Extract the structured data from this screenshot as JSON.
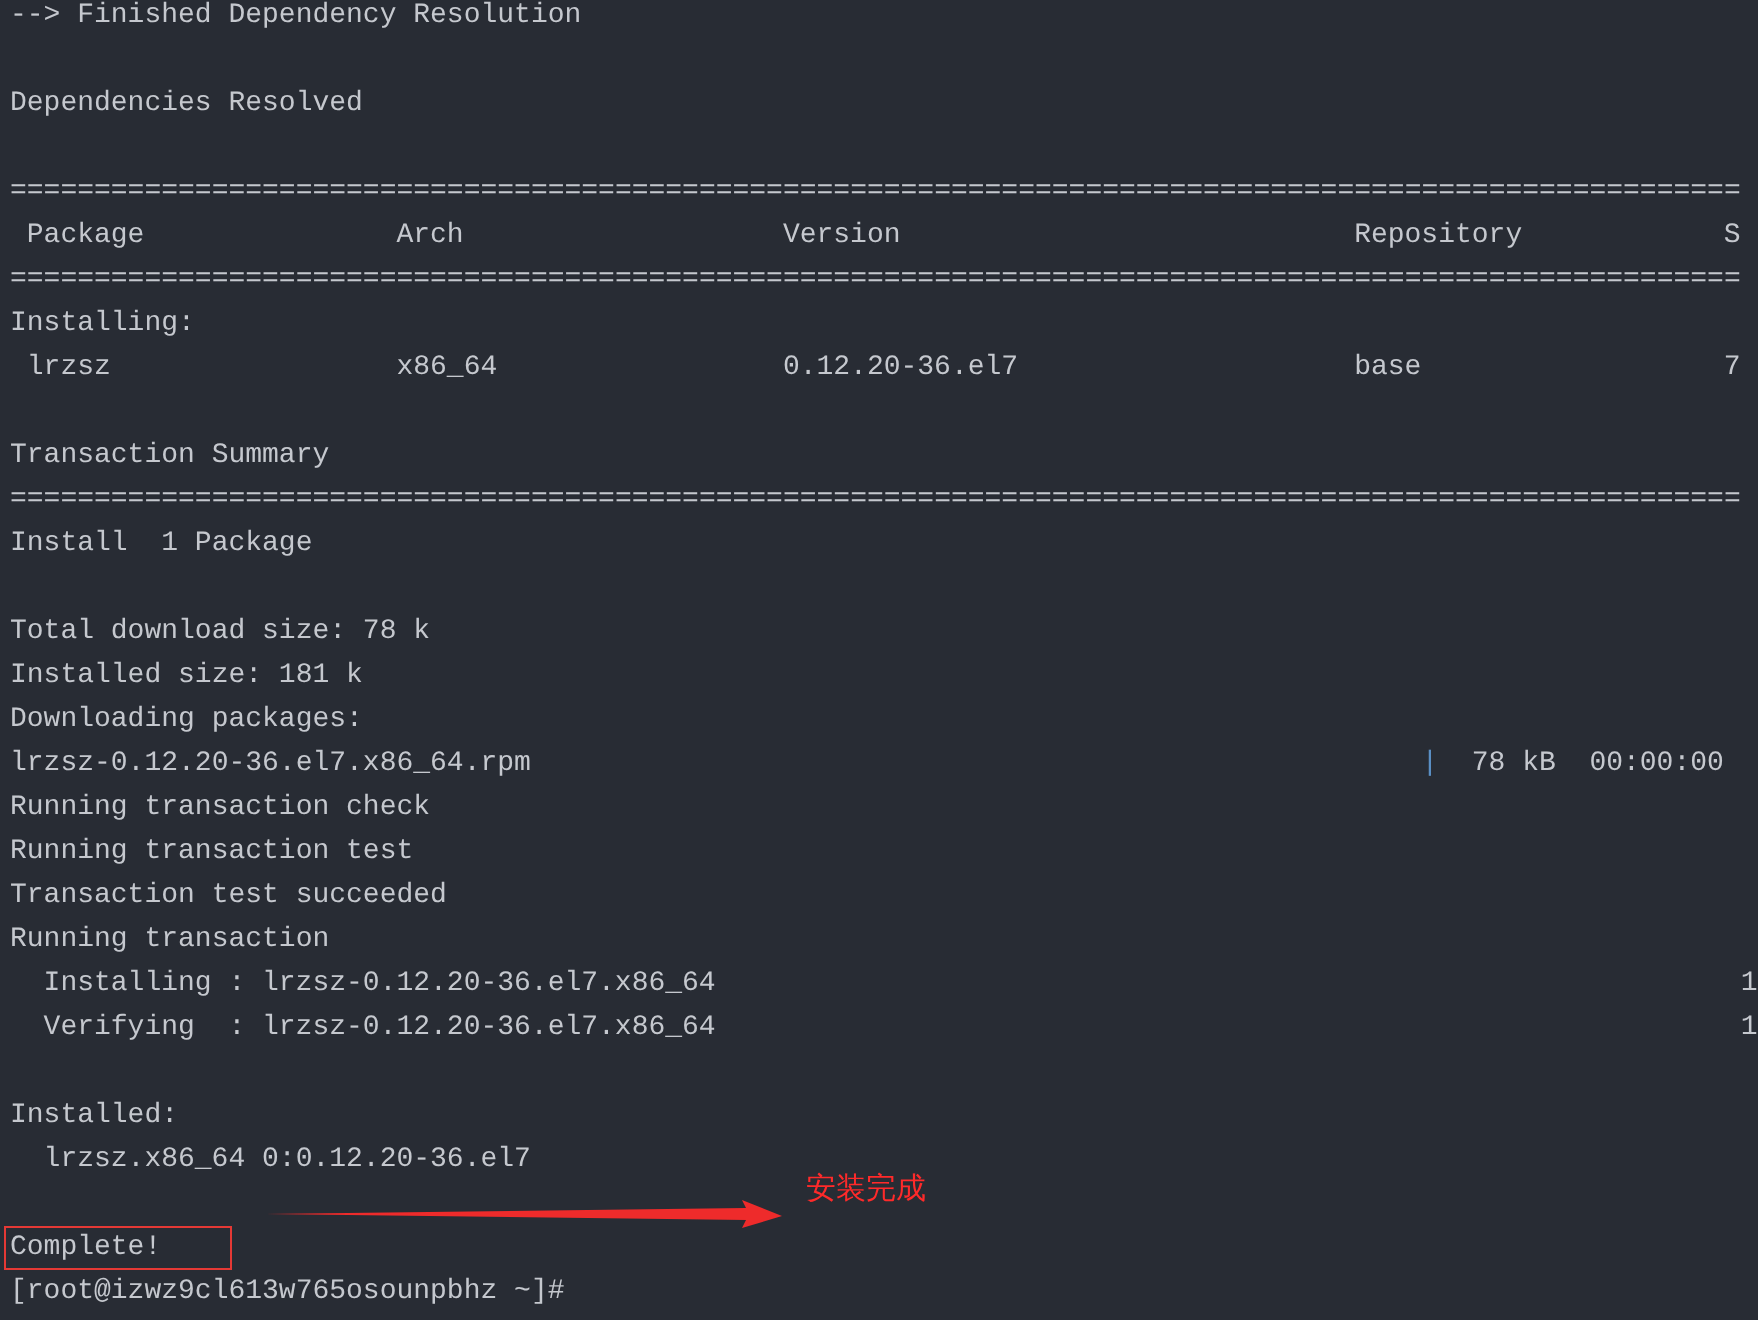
{
  "terminal": {
    "lines": [
      {
        "kind": "text",
        "text": "--> Finished Dependency Resolution"
      },
      {
        "kind": "blank"
      },
      {
        "kind": "text",
        "text": "Dependencies Resolved"
      },
      {
        "kind": "blank"
      },
      {
        "kind": "rule",
        "text": "======================================================================================================="
      },
      {
        "kind": "columns",
        "cells": [
          "Package",
          "Arch",
          "Version",
          "Repository",
          "S"
        ]
      },
      {
        "kind": "rule",
        "text": "======================================================================================================="
      },
      {
        "kind": "text",
        "text": "Installing:"
      },
      {
        "kind": "columns",
        "cells": [
          "lrzsz",
          "x86_64",
          "0.12.20-36.el7",
          "base",
          "7"
        ]
      },
      {
        "kind": "blank"
      },
      {
        "kind": "text",
        "text": "Transaction Summary"
      },
      {
        "kind": "rule",
        "text": "======================================================================================================="
      },
      {
        "kind": "text",
        "text": "Install  1 Package"
      },
      {
        "kind": "blank"
      },
      {
        "kind": "text",
        "text": "Total download size: 78 k"
      },
      {
        "kind": "text",
        "text": "Installed size: 181 k"
      },
      {
        "kind": "text",
        "text": "Downloading packages:"
      },
      {
        "kind": "download",
        "file": "lrzsz-0.12.20-36.el7.x86_64.rpm",
        "bar": "|",
        "size": "78 kB",
        "time": "00:00:00"
      },
      {
        "kind": "text",
        "text": "Running transaction check"
      },
      {
        "kind": "text",
        "text": "Running transaction test"
      },
      {
        "kind": "text",
        "text": "Transaction test succeeded"
      },
      {
        "kind": "text",
        "text": "Running transaction"
      },
      {
        "kind": "step",
        "action": "Installing",
        "separator": ":",
        "package": "lrzsz-0.12.20-36.el7.x86_64",
        "count": "1"
      },
      {
        "kind": "step",
        "action": "Verifying",
        "separator": ":",
        "package": "lrzsz-0.12.20-36.el7.x86_64",
        "count": "1"
      },
      {
        "kind": "blank"
      },
      {
        "kind": "text",
        "text": "Installed:"
      },
      {
        "kind": "detail",
        "text": "lrzsz.x86_64 0:0.12.20-36.el7"
      },
      {
        "kind": "blank"
      },
      {
        "kind": "highlight",
        "text": "Complete!"
      },
      {
        "kind": "text",
        "text": "[root@izwz9cl613w765osounpbhz ~]#"
      }
    ]
  },
  "annotation": {
    "text": "安装完成"
  }
}
